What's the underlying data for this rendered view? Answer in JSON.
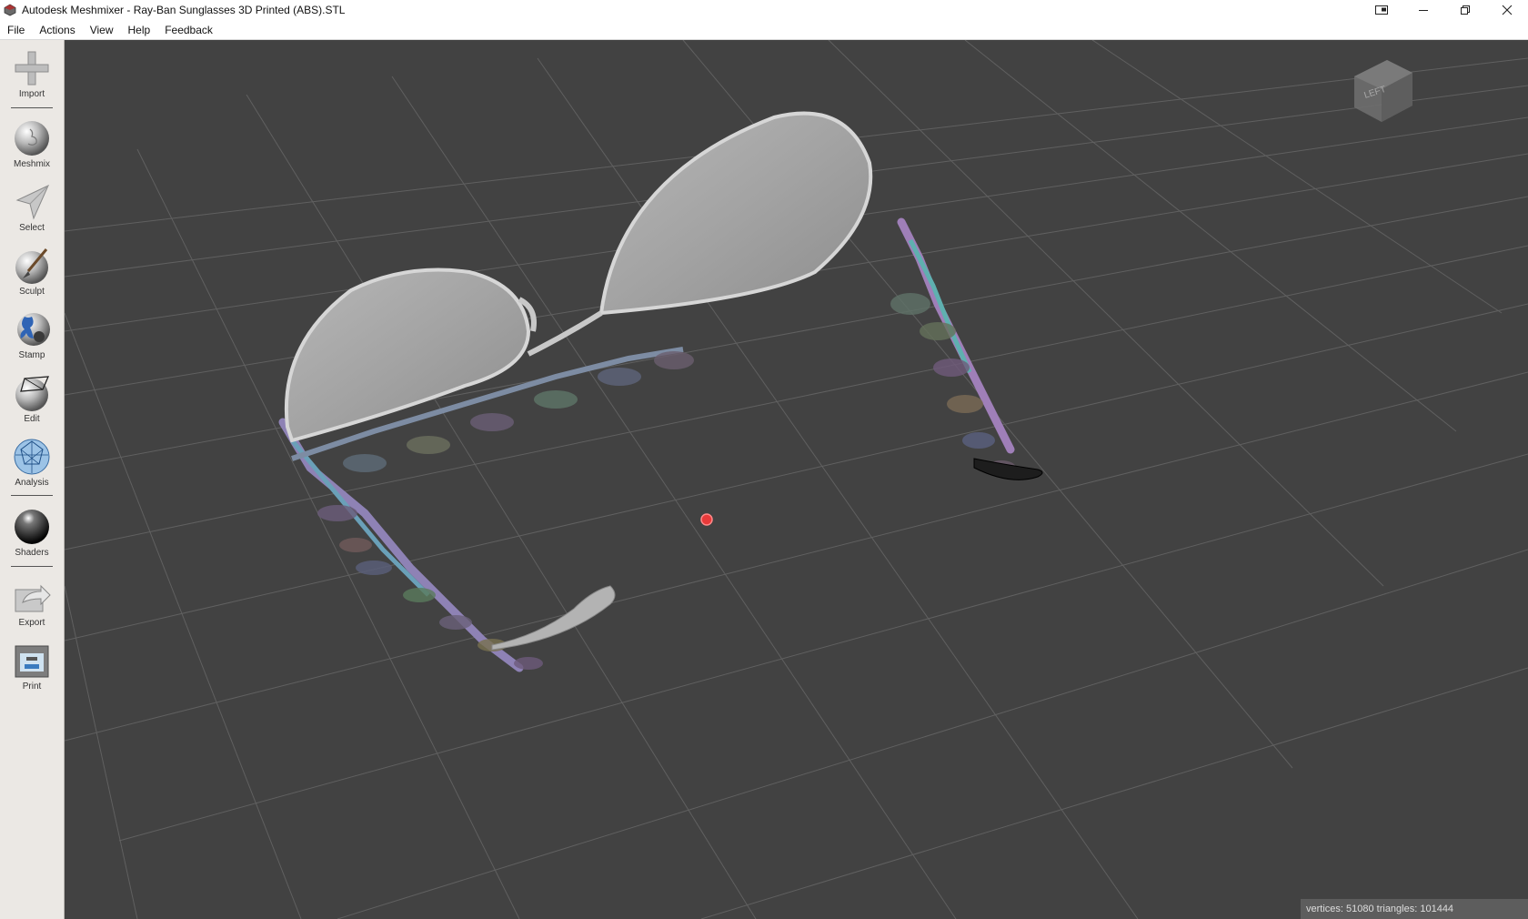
{
  "window": {
    "title": "Autodesk Meshmixer - Ray-Ban Sunglasses 3D Printed (ABS).STL"
  },
  "menu": [
    "File",
    "Actions",
    "View",
    "Help",
    "Feedback"
  ],
  "toolbar": {
    "import": "Import",
    "meshmix": "Meshmix",
    "select": "Select",
    "sculpt": "Sculpt",
    "stamp": "Stamp",
    "edit": "Edit",
    "analysis": "Analysis",
    "shaders": "Shaders",
    "export": "Export",
    "print": "Print"
  },
  "viewcube": {
    "label": "LEFT"
  },
  "status": {
    "text": "vertices: 51080 triangles: 101444"
  },
  "colors": {
    "viewport_bg": "#424242",
    "toolbar_bg": "#ebe8e4",
    "pivot": "#e83a3a"
  }
}
